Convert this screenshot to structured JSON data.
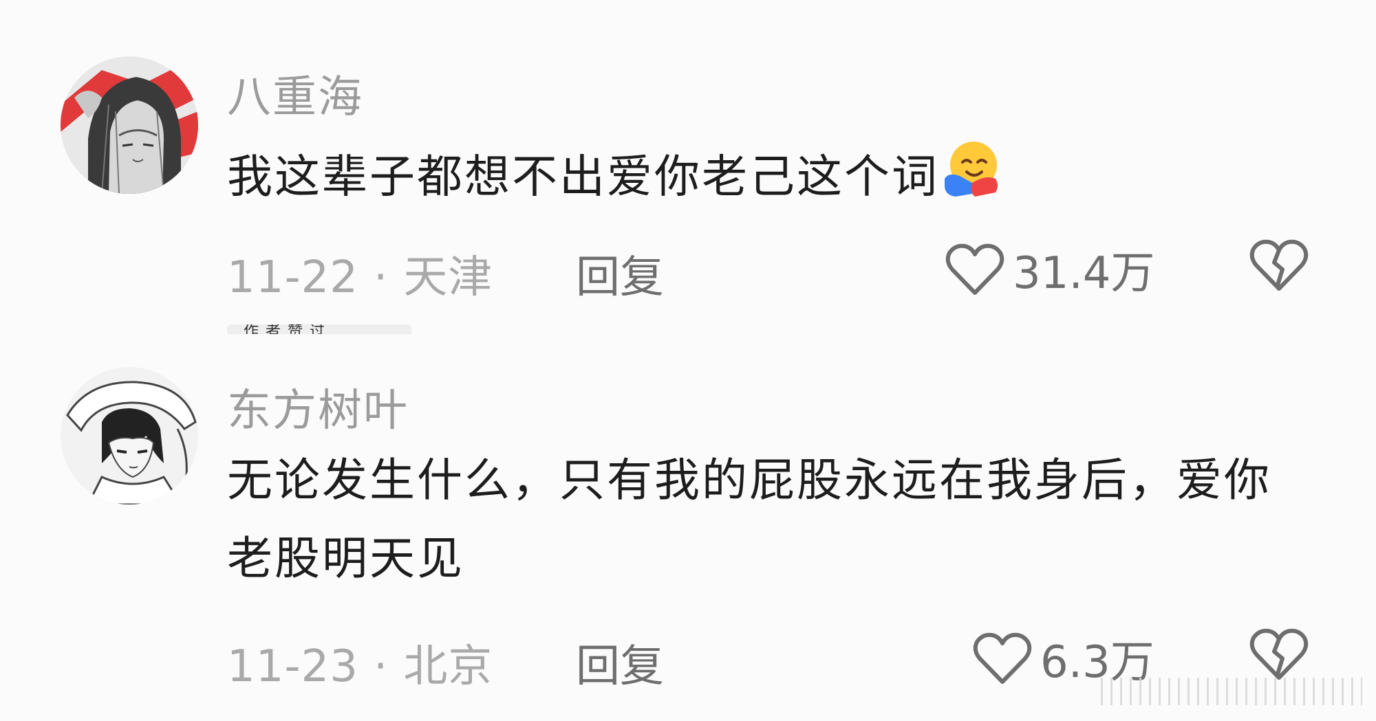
{
  "comments": [
    {
      "username": "八重海",
      "content": "我这辈子都想不出爱你老己这个词",
      "emoji": "hugging-face-emoji",
      "date": "11-22",
      "location": "天津",
      "reply_label": "回复",
      "likes": "31.4万",
      "avatar": "anime-hooded-character-avatar"
    },
    {
      "username": "东方树叶",
      "content": "无论发生什么，只有我的屁股永远在我身后，爱你老股明天见",
      "date": "11-23",
      "location": "北京",
      "reply_label": "回复",
      "likes": "6.3万",
      "avatar": "anime-sketch-character-avatar"
    }
  ],
  "separator_dot": "·",
  "partial_tab_text": "作者赞过",
  "colors": {
    "background": "#fbfbfb",
    "text_primary": "#1d1d1d",
    "text_secondary": "#9b9b9b",
    "icon": "#6e6e6e"
  }
}
